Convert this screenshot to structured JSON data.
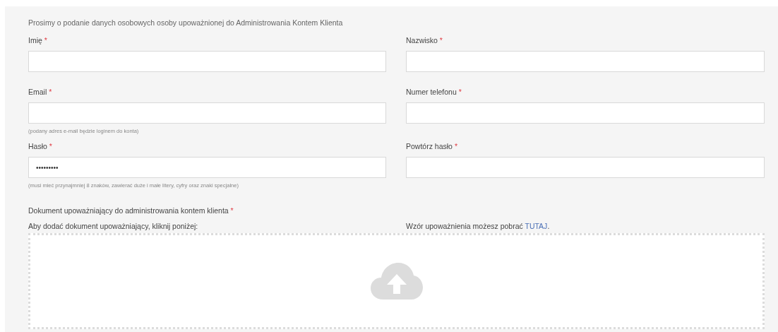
{
  "intro": "Prosimy o podanie danych osobowych osoby upoważnionej do Administrowania Kontem Klienta",
  "rows": [
    [
      {
        "label": "Imię",
        "mark": "*"
      },
      {
        "label": "Nazwisko",
        "mark": "*"
      }
    ],
    [
      {
        "label": "Email",
        "mark": "*",
        "hint": "(podany adres e-mail będzie loginem do konta)"
      },
      {
        "label": "Numer telefonu",
        "mark": "*"
      }
    ],
    [
      {
        "label": "Hasło",
        "mark": "*",
        "value": "•••••••••",
        "hint": "(musi mieć przynajmniej 8 znaków, zawierać duże i małe litery, cyfry oraz znaki specjalne)"
      },
      {
        "label": "Powtórz hasło",
        "mark": "*"
      }
    ]
  ],
  "document": {
    "label": "Dokument upoważniający do administrowania kontem klienta",
    "mark": "*",
    "instruction": "Aby dodać dokument upoważniający, kliknij poniżej:",
    "template_prefix": "Wzór upoważnienia możesz pobrać ",
    "template_link": "TUTAJ",
    "template_suffix": "."
  }
}
